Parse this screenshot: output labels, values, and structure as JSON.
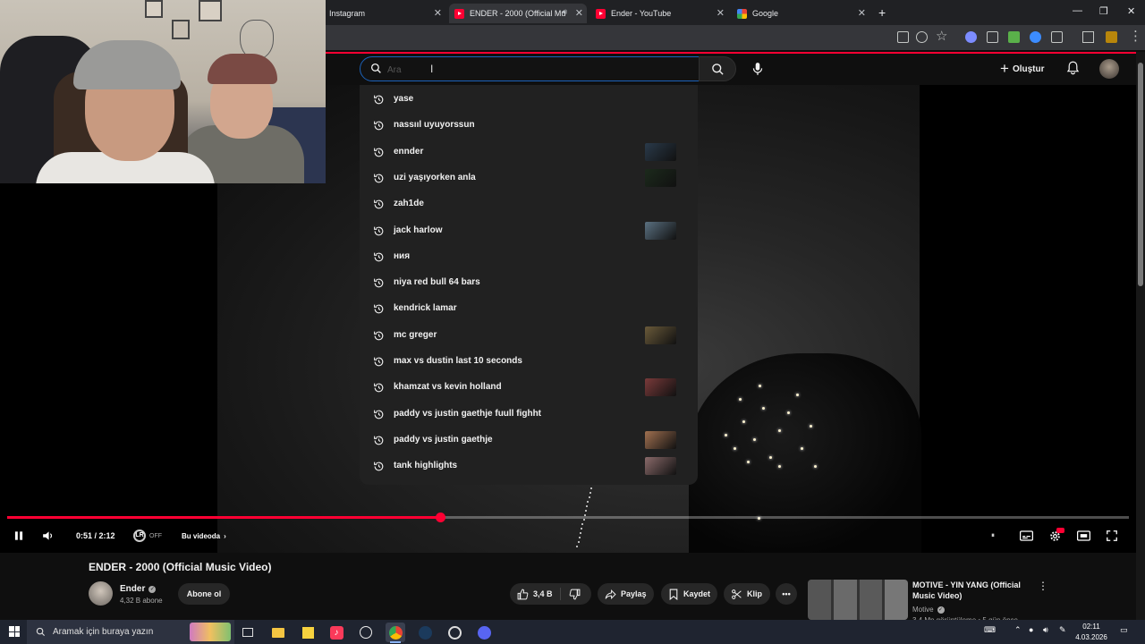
{
  "browser": {
    "tabs": [
      {
        "label": "Instagram",
        "active": false
      },
      {
        "label": "ENDER - 2000 (Official Mu",
        "active": true
      },
      {
        "label": "Ender - YouTube",
        "active": false
      },
      {
        "label": "Google",
        "active": false
      }
    ]
  },
  "masthead": {
    "search_placeholder": "Ara",
    "create_label": "Oluştur"
  },
  "suggestions": [
    {
      "text": "yase",
      "has_thumb": false
    },
    {
      "text": "nassııl uyuyorssun",
      "has_thumb": false
    },
    {
      "text": "ennder",
      "has_thumb": true,
      "thumb_color": "#2a3a4a"
    },
    {
      "text": "uzi yaşıyorken anla",
      "has_thumb": true,
      "thumb_color": "#1c2a1c"
    },
    {
      "text": "zah1de",
      "has_thumb": false
    },
    {
      "text": "jack harlow",
      "has_thumb": true,
      "thumb_color": "#5a7080"
    },
    {
      "text": "ния",
      "has_thumb": false
    },
    {
      "text": "niya red bull 64 bars",
      "has_thumb": false
    },
    {
      "text": "kendrick lamar",
      "has_thumb": false
    },
    {
      "text": "mc greger",
      "has_thumb": true,
      "thumb_color": "#6a5a3a"
    },
    {
      "text": "max vs dustin last 10 seconds",
      "has_thumb": false
    },
    {
      "text": "khamzat vs kevin holland",
      "has_thumb": true,
      "thumb_color": "#7a3a3a"
    },
    {
      "text": "paddy vs justin gaethje fuull fighht",
      "has_thumb": false
    },
    {
      "text": "paddy vs justin gaethje",
      "has_thumb": true,
      "thumb_color": "#a07050"
    },
    {
      "text": "tank highlights",
      "has_thumb": true,
      "thumb_color": "#8a6a6a"
    }
  ],
  "player": {
    "time": "0:51 / 2:12",
    "progress": 0.386,
    "autoplay_label": "OFF",
    "chapter_label": "Bu videoda"
  },
  "video": {
    "title": "ENDER - 2000 (Official Music Video)",
    "channel": "Ender",
    "subscribers": "4,32 B abone",
    "subscribe_label": "Abone ol",
    "likes": "3,4 B",
    "share_label": "Paylaş",
    "save_label": "Kaydet",
    "clip_label": "Klip"
  },
  "recommendation": {
    "title": "MOTIVE - YIN YANG (Official Music Video)",
    "channel": "Motive",
    "meta": "3,4 Mn görüntüleme • 5 gün önce"
  },
  "taskbar": {
    "search_text": "Aramak için buraya yazın",
    "time": "02:11",
    "date": "4.03.2026"
  },
  "colors": {
    "youtube_red": "#ff0033",
    "dropdown_bg": "#212121",
    "page_bg": "#0f0f0f"
  }
}
